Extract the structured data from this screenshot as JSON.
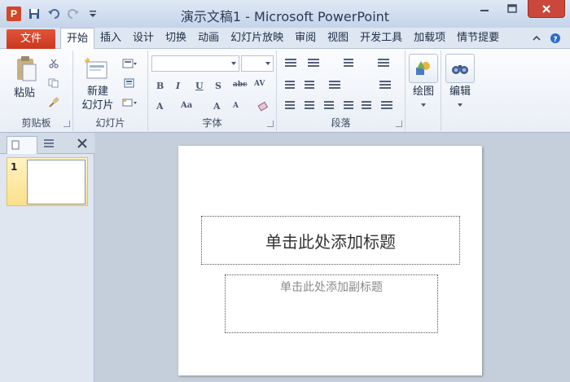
{
  "window": {
    "title": "演示文稿1 - Microsoft PowerPoint",
    "app_icon_letter": "P"
  },
  "ribbon_tabs": {
    "file": "文件",
    "items": [
      "开始",
      "插入",
      "设计",
      "切换",
      "动画",
      "幻灯片放映",
      "审阅",
      "视图",
      "开发工具",
      "加载项",
      "情节提要"
    ],
    "active": "开始"
  },
  "groups": {
    "clipboard": {
      "label": "剪贴板",
      "paste": "粘贴"
    },
    "slides": {
      "label": "幻灯片",
      "new_slide_line1": "新建",
      "new_slide_line2": "幻灯片"
    },
    "font": {
      "label": "字体",
      "font_name": "",
      "font_size": ""
    },
    "paragraph": {
      "label": "段落"
    },
    "drawing": {
      "label": "绘图"
    },
    "editing": {
      "label": "编辑"
    }
  },
  "slides_panel": {
    "thumbnails": [
      {
        "number": "1"
      }
    ]
  },
  "slide": {
    "title_placeholder": "单击此处添加标题",
    "subtitle_placeholder": "单击此处添加副标题"
  },
  "colors": {
    "file_tab": "#d24726",
    "accent": "#2b579a",
    "selected_thumb": "#fbe08a"
  }
}
